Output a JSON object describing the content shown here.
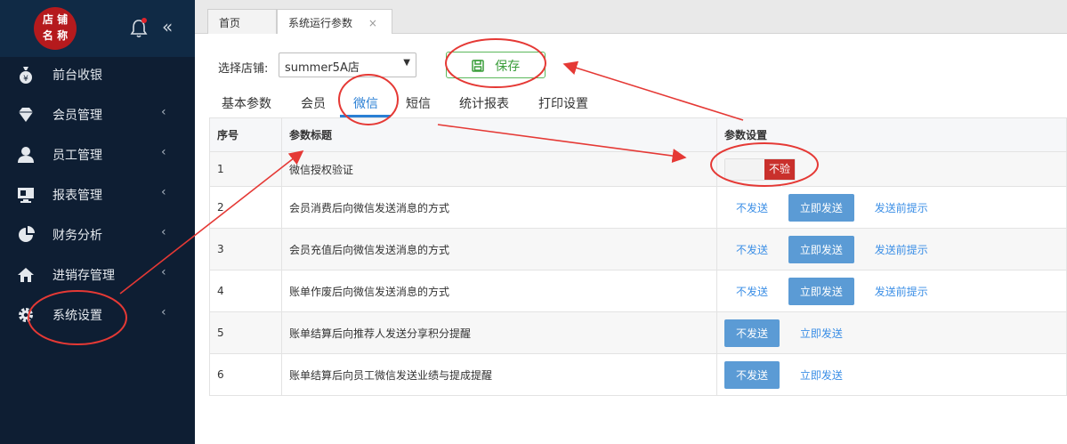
{
  "sidebar": {
    "logo": [
      "店 铺",
      "名 称"
    ],
    "items": [
      {
        "label": "前台收银",
        "icon": "money-bag-icon",
        "has_chevron": false
      },
      {
        "label": "会员管理",
        "icon": "diamond-icon",
        "has_chevron": true
      },
      {
        "label": "员工管理",
        "icon": "user-icon",
        "has_chevron": true
      },
      {
        "label": "报表管理",
        "icon": "monitor-icon",
        "has_chevron": true
      },
      {
        "label": "财务分析",
        "icon": "pie-chart-icon",
        "has_chevron": true
      },
      {
        "label": "进销存管理",
        "icon": "home-icon",
        "has_chevron": true
      },
      {
        "label": "系统设置",
        "icon": "gear-icon",
        "has_chevron": true
      }
    ],
    "chevron": "‹",
    "collapse": "«"
  },
  "tabs": [
    {
      "label": "首页",
      "active": false
    },
    {
      "label": "系统运行参数",
      "active": true,
      "close": "×"
    }
  ],
  "toolbar": {
    "shop_label": "选择店铺:",
    "shop_value": "summer5A店",
    "save_label": "保存"
  },
  "param_tabs": [
    "基本参数",
    "会员",
    "微信",
    "短信",
    "统计报表",
    "打印设置"
  ],
  "active_param_tab": "微信",
  "table": {
    "headers": [
      "序号",
      "参数标题",
      "参数设置"
    ],
    "rows": [
      {
        "no": "1",
        "title": "微信授权验证",
        "toggle": "不验证"
      },
      {
        "no": "2",
        "title": "会员消费后向微信发送消息的方式",
        "options": [
          "不发送",
          "立即发送",
          "发送前提示"
        ],
        "selected": 1
      },
      {
        "no": "3",
        "title": "会员充值后向微信发送消息的方式",
        "options": [
          "不发送",
          "立即发送",
          "发送前提示"
        ],
        "selected": 1
      },
      {
        "no": "4",
        "title": "账单作废后向微信发送消息的方式",
        "options": [
          "不发送",
          "立即发送",
          "发送前提示"
        ],
        "selected": 1
      },
      {
        "no": "5",
        "title": "账单结算后向推荐人发送分享积分提醒",
        "options": [
          "不发送",
          "立即发送"
        ],
        "selected": 0
      },
      {
        "no": "6",
        "title": "账单结算后向员工微信发送业绩与提成提醒",
        "options": [
          "不发送",
          "立即发送"
        ],
        "selected": 0
      }
    ]
  },
  "colors": {
    "sidebar_bg": "#0e1e33",
    "accent_blue": "#2a7fd4",
    "save_green": "#3a9d3a",
    "toggle_red": "#c9302c",
    "annotation_red": "#e53935"
  }
}
